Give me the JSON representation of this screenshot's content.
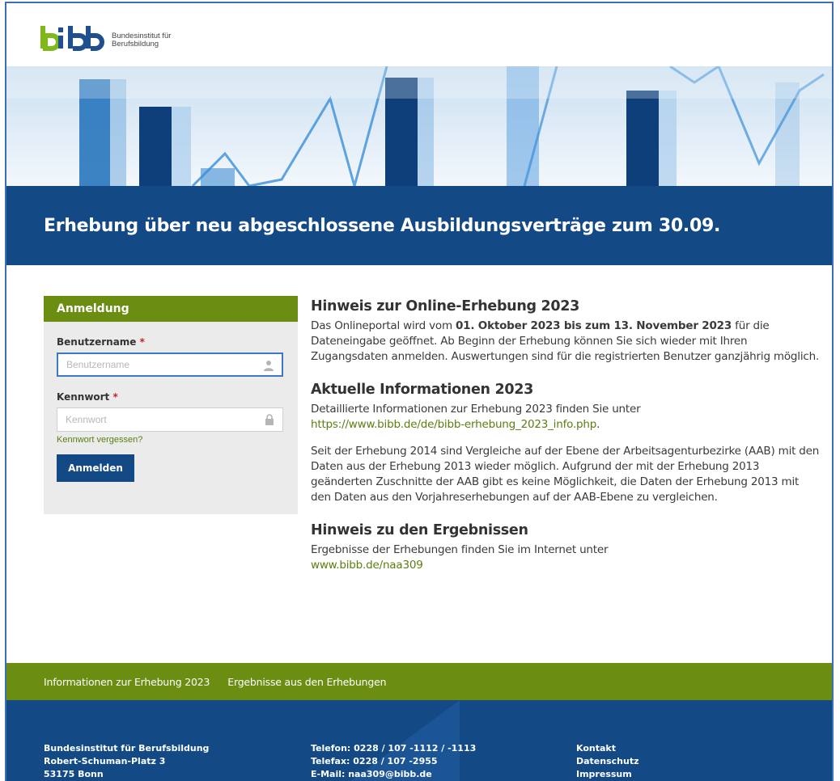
{
  "logo": {
    "line1": "Bundesinstitut für",
    "line2": "Berufsbildung"
  },
  "banner": {
    "title": "Erhebung über neu abgeschlossene Ausbildungsverträge zum 30.09."
  },
  "login": {
    "heading": "Anmeldung",
    "username_label": "Benutzername",
    "username_placeholder": "Benutzername",
    "password_label": "Kennwort",
    "password_placeholder": "Kennwort",
    "required_mark": "*",
    "forgot_link": "Kennwort vergessen?",
    "submit_label": "Anmelden"
  },
  "content": {
    "hinweis_title": "Hinweis zur Online-Erhebung 2023",
    "hinweis_text_1": "Das Onlineportal wird vom ",
    "hinweis_bold": "01. Oktober 2023 bis zum 13. November 2023",
    "hinweis_text_2": " für die Dateneingabe geöffnet. Ab Beginn der Erhebung können Sie sich wieder mit Ihren Zugangsdaten anmelden. Auswertungen sind für die registrierten Benutzer ganzjährig möglich.",
    "aktuell_title": "Aktuelle Informationen 2023",
    "aktuell_text": "Detaillierte Informationen zur Erhebung 2023 finden Sie unter",
    "aktuell_link": "https://www.bibb.de/de/bibb-erhebung_2023_info.php",
    "aktuell_link_suffix": ".",
    "vergleich_text": "Seit der Erhebung 2014 sind Vergleiche auf der Ebene der Arbeitsagenturbezirke (AAB) mit den Daten aus der Erhebung 2013 wieder möglich. Aufgrund der mit der Erhebung 2013 geänderten Zuschnitte der AAB gibt es keine Möglichkeit, die Daten der Erhebung 2013 mit den Daten aus den Vorjahreserhebungen auf der AAB-Ebene zu vergleichen.",
    "ergebnisse_title": "Hinweis zu den Ergebnissen",
    "ergebnisse_text": "Ergebnisse der Erhebungen finden Sie im Internet unter",
    "ergebnisse_link": "www.bibb.de/naa309"
  },
  "footer_nav": {
    "items": [
      "Informationen zur Erhebung 2023",
      "Ergebnisse aus den Erhebungen"
    ]
  },
  "footer": {
    "address": [
      "Bundesinstitut für Berufsbildung",
      "Robert-Schuman-Platz 3",
      "53175 Bonn"
    ],
    "contact": [
      "Telefon: 0228 / 107 -1112 / -1113",
      "Telefax: 0228 / 107 -2955",
      "E-Mail: naa309@bibb.de"
    ],
    "links": [
      "Kontakt",
      "Datenschutz",
      "Impressum"
    ]
  },
  "colors": {
    "brand_blue": "#134a86",
    "brand_green": "#6b8e12",
    "link_green": "#5a7f0f",
    "required_red": "#c0261f"
  },
  "icons": {
    "username_field": "user-icon",
    "password_field": "lock-icon"
  }
}
